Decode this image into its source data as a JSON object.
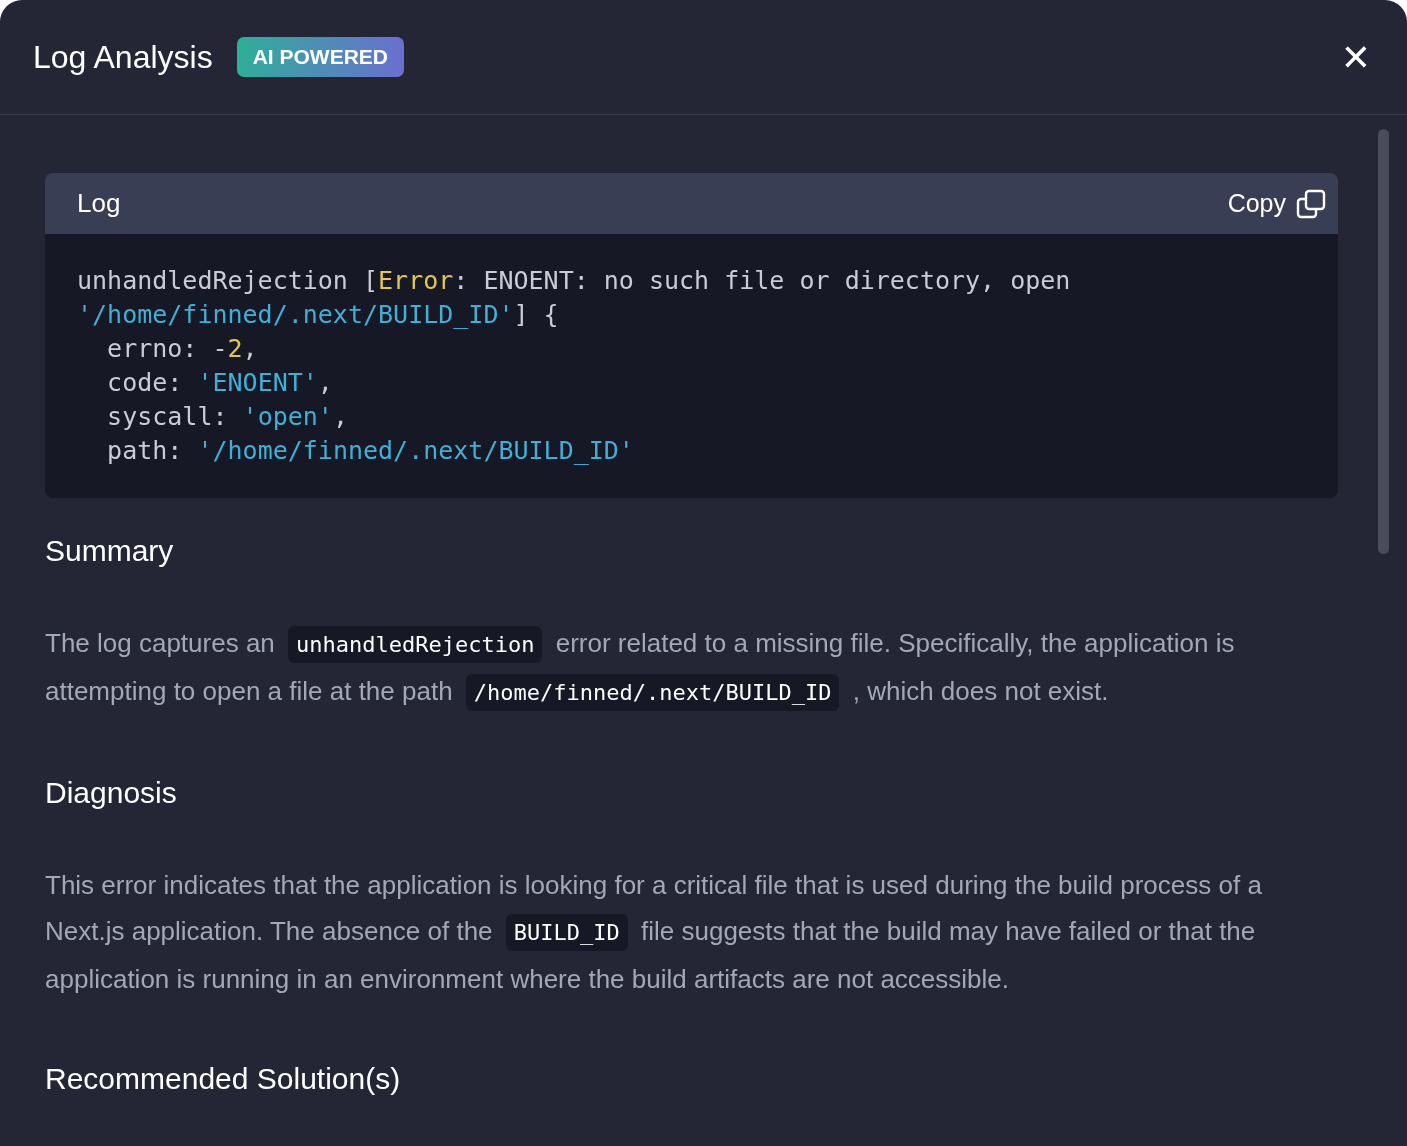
{
  "dialog": {
    "title": "Log Analysis",
    "badge": "AI POWERED",
    "close": "✕"
  },
  "log": {
    "title": "Log",
    "copy_label": "Copy",
    "lines": [
      [
        {
          "kind": "plain",
          "text": "unhandledRejection ["
        },
        {
          "kind": "keyword",
          "text": "Error"
        },
        {
          "kind": "plain",
          "text": ": ENOENT: no such file or directory, open"
        }
      ],
      [
        {
          "kind": "string",
          "text": "'/home/finned/.next/BUILD_ID'"
        },
        {
          "kind": "plain",
          "text": "] {"
        }
      ],
      [
        {
          "kind": "plain",
          "text": "  errno: -"
        },
        {
          "kind": "number",
          "text": "2"
        },
        {
          "kind": "plain",
          "text": ","
        }
      ],
      [
        {
          "kind": "plain",
          "text": "  code: "
        },
        {
          "kind": "string",
          "text": "'ENOENT'"
        },
        {
          "kind": "plain",
          "text": ","
        }
      ],
      [
        {
          "kind": "plain",
          "text": "  syscall: "
        },
        {
          "kind": "string",
          "text": "'open'"
        },
        {
          "kind": "plain",
          "text": ","
        }
      ],
      [
        {
          "kind": "plain",
          "text": "  path: "
        },
        {
          "kind": "string",
          "text": "'/home/finned/.next/BUILD_ID'"
        }
      ]
    ]
  },
  "sections": [
    {
      "heading": "Summary",
      "paragraph": [
        {
          "kind": "text",
          "text": "The log captures an"
        },
        {
          "kind": "code",
          "text": "unhandledRejection"
        },
        {
          "kind": "text",
          "text": "error related to a missing file. Specifically, the application is attempting to open a file at the path"
        },
        {
          "kind": "code",
          "text": "/home/finned/.next/BUILD_ID"
        },
        {
          "kind": "text",
          "text": ", which does not exist."
        }
      ]
    },
    {
      "heading": "Diagnosis",
      "paragraph": [
        {
          "kind": "text",
          "text": "This error indicates that the application is looking for a critical file that is used during the build process of a Next.js application. The absence of the"
        },
        {
          "kind": "code",
          "text": "BUILD_ID"
        },
        {
          "kind": "text",
          "text": "file suggests that the build may have failed or that the application is running in an environment where the build artifacts are not accessible."
        }
      ]
    },
    {
      "heading": "Recommended Solution(s)"
    }
  ]
}
